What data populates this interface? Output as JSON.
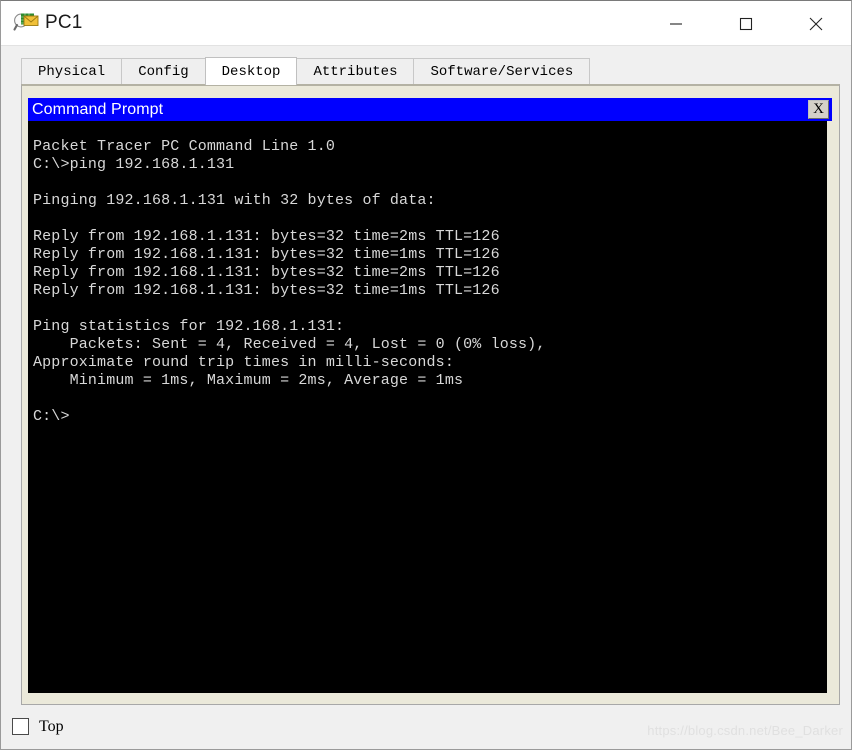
{
  "window": {
    "title": "PC1",
    "icon": "packet-tracer-inspect-icon",
    "controls": {
      "minimize": "—",
      "maximize": "□",
      "close": "✕"
    }
  },
  "tabs": [
    {
      "label": "Physical",
      "active": false
    },
    {
      "label": "Config",
      "active": false
    },
    {
      "label": "Desktop",
      "active": true
    },
    {
      "label": "Attributes",
      "active": false
    },
    {
      "label": "Software/Services",
      "active": false
    }
  ],
  "command_prompt": {
    "title": "Command Prompt",
    "close_label": "X",
    "titlebar_color": "#0000ff",
    "screen_color": "#000000",
    "text_color": "#d8d8d8",
    "output": "Packet Tracer PC Command Line 1.0\nC:\\>ping 192.168.1.131\n\nPinging 192.168.1.131 with 32 bytes of data:\n\nReply from 192.168.1.131: bytes=32 time=2ms TTL=126\nReply from 192.168.1.131: bytes=32 time=1ms TTL=126\nReply from 192.168.1.131: bytes=32 time=2ms TTL=126\nReply from 192.168.1.131: bytes=32 time=1ms TTL=126\n\nPing statistics for 192.168.1.131:\n    Packets: Sent = 4, Received = 4, Lost = 0 (0% loss),\nApproximate round trip times in milli-seconds:\n    Minimum = 1ms, Maximum = 2ms, Average = 1ms\n\nC:\\>",
    "session": {
      "banner": "Packet Tracer PC Command Line 1.0",
      "command": "ping 192.168.1.131",
      "target_host": "192.168.1.131",
      "payload_bytes": "32",
      "replies": [
        {
          "from": "192.168.1.131",
          "bytes": "32",
          "time": "2ms",
          "ttl": "126"
        },
        {
          "from": "192.168.1.131",
          "bytes": "32",
          "time": "1ms",
          "ttl": "126"
        },
        {
          "from": "192.168.1.131",
          "bytes": "32",
          "time": "2ms",
          "ttl": "126"
        },
        {
          "from": "192.168.1.131",
          "bytes": "32",
          "time": "1ms",
          "ttl": "126"
        }
      ],
      "statistics": {
        "sent": "4",
        "received": "4",
        "lost": "0",
        "loss_percent": "0%",
        "minimum": "1ms",
        "maximum": "2ms",
        "average": "1ms"
      },
      "prompt": "C:\\>"
    }
  },
  "bottom": {
    "top_checkbox_label": "Top",
    "top_checkbox_checked": false
  },
  "watermark": "https://blog.csdn.net/Bee_Darker"
}
